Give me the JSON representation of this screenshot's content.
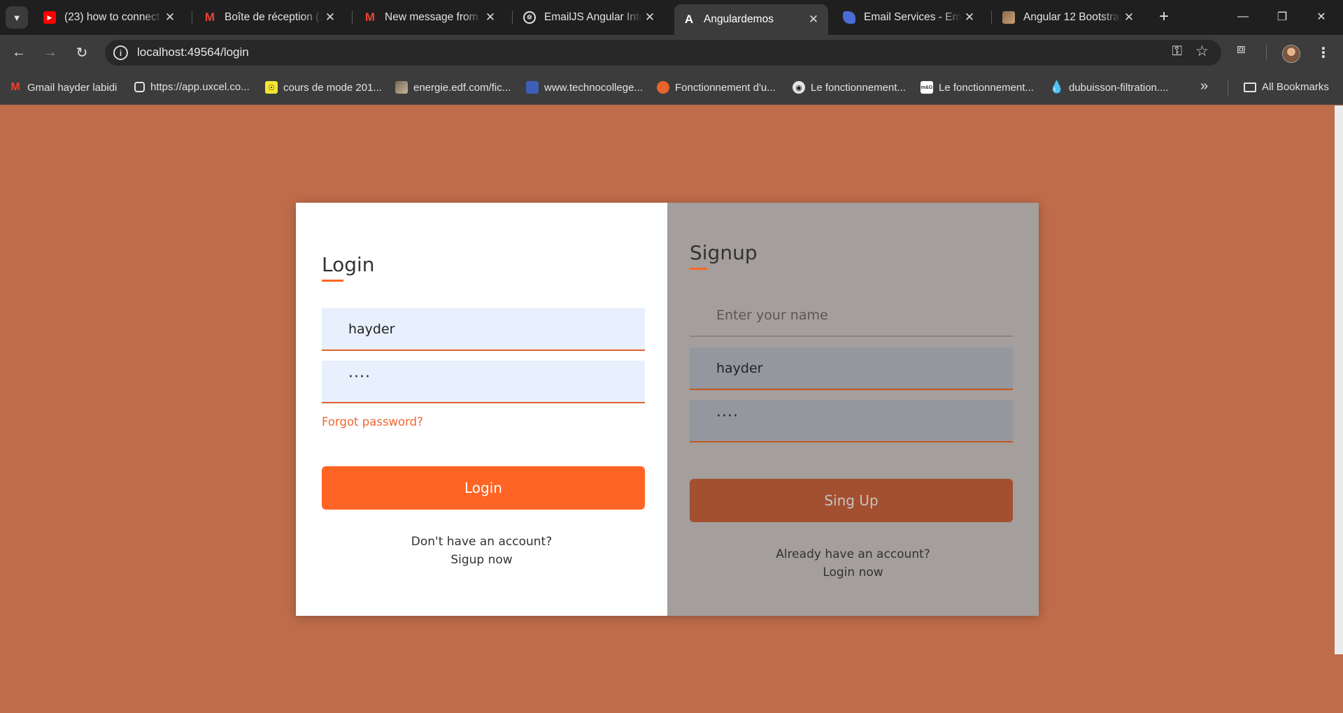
{
  "browser": {
    "tabs": [
      {
        "title": "(23) how to connect an",
        "icon": "youtube-icon",
        "active": false
      },
      {
        "title": "Boîte de réception (1",
        "icon": "gmail-icon",
        "active": false
      },
      {
        "title": "New message from -",
        "icon": "gmail-icon",
        "active": false
      },
      {
        "title": "EmailJS Angular Integ",
        "icon": "openai-icon",
        "active": false
      },
      {
        "title": "Angulardemos",
        "icon": "angular-icon",
        "active": true
      },
      {
        "title": "Email Services - Email",
        "icon": "emailjs-icon",
        "active": false
      },
      {
        "title": "Angular 12 Bootstrap",
        "icon": "image-icon",
        "active": false
      }
    ],
    "url": "localhost:49564/login",
    "bookmarks": [
      {
        "label": "Gmail hayder labidi",
        "icon": "gmail-icon"
      },
      {
        "label": "https://app.uxcel.co...",
        "icon": "uxcel-icon"
      },
      {
        "label": "cours de mode 201...",
        "icon": "coursera-icon"
      },
      {
        "label": "energie.edf.com/fic...",
        "icon": "image-icon"
      },
      {
        "label": "www.technocollege...",
        "icon": "technocollege-icon"
      },
      {
        "label": "Fonctionnement d'u...",
        "icon": "hexagon-icon"
      },
      {
        "label": "Le fonctionnement...",
        "icon": "radio-icon"
      },
      {
        "label": "Le fonctionnement...",
        "icon": "msg-icon"
      },
      {
        "label": "dubuisson-filtration....",
        "icon": "drop-icon"
      }
    ],
    "all_bookmarks": "All Bookmarks"
  },
  "login": {
    "title": "Login",
    "username_value": "hayder",
    "password_value": "····",
    "forgot": "Forgot password?",
    "button": "Login",
    "switch_question": "Don't have an account?",
    "switch_link": "Sigup now"
  },
  "signup": {
    "title": "Signup",
    "name_placeholder": "Enter your name",
    "username_value": "hayder",
    "password_value": "····",
    "button": "Sing Up",
    "switch_question": "Already have an account?",
    "switch_link": "Login now"
  },
  "colors": {
    "page_background": "#bf6c4a",
    "accent": "#ff6424",
    "signup_panel": "#a49e9c"
  }
}
